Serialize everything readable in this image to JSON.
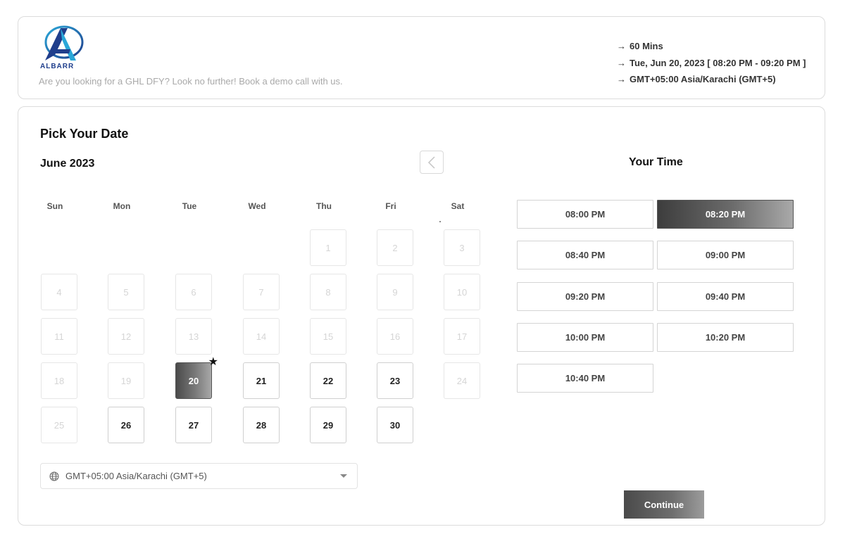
{
  "header": {
    "brand": "ALBARR",
    "tagline": "Are you looking for a GHL DFY? Look no further! Book a demo call with us.",
    "summary": {
      "duration": "60 Mins",
      "datetime": "Tue, Jun 20, 2023 [ 08:20 PM - 09:20 PM ]",
      "timezone": "GMT+05:00 Asia/Karachi (GMT+5)"
    }
  },
  "calendar": {
    "title": "Pick Your Date",
    "month": "June 2023",
    "weekdays": [
      "Sun",
      "Mon",
      "Tue",
      "Wed",
      "Thu",
      "Fri",
      "Sat"
    ],
    "selected_day": "20",
    "days": [
      {
        "label": "1",
        "state": "disabled"
      },
      {
        "label": "2",
        "state": "disabled"
      },
      {
        "label": "3",
        "state": "disabled"
      },
      {
        "label": "4",
        "state": "disabled"
      },
      {
        "label": "5",
        "state": "disabled"
      },
      {
        "label": "6",
        "state": "disabled"
      },
      {
        "label": "7",
        "state": "disabled"
      },
      {
        "label": "8",
        "state": "disabled"
      },
      {
        "label": "9",
        "state": "disabled"
      },
      {
        "label": "10",
        "state": "disabled"
      },
      {
        "label": "11",
        "state": "disabled"
      },
      {
        "label": "12",
        "state": "disabled"
      },
      {
        "label": "13",
        "state": "disabled"
      },
      {
        "label": "14",
        "state": "disabled"
      },
      {
        "label": "15",
        "state": "disabled"
      },
      {
        "label": "16",
        "state": "disabled"
      },
      {
        "label": "17",
        "state": "disabled"
      },
      {
        "label": "18",
        "state": "disabled"
      },
      {
        "label": "19",
        "state": "disabled"
      },
      {
        "label": "20",
        "state": "selected"
      },
      {
        "label": "21",
        "state": "enabled"
      },
      {
        "label": "22",
        "state": "enabled"
      },
      {
        "label": "23",
        "state": "enabled"
      },
      {
        "label": "24",
        "state": "disabled"
      },
      {
        "label": "25",
        "state": "disabled"
      },
      {
        "label": "26",
        "state": "enabled"
      },
      {
        "label": "27",
        "state": "enabled"
      },
      {
        "label": "28",
        "state": "enabled"
      },
      {
        "label": "29",
        "state": "enabled"
      },
      {
        "label": "30",
        "state": "enabled"
      }
    ],
    "timezone_select": "GMT+05:00 Asia/Karachi (GMT+5)"
  },
  "time": {
    "title": "Your Time",
    "selected": "08:20 PM",
    "slots": [
      "08:00 PM",
      "08:20 PM",
      "08:40 PM",
      "09:00 PM",
      "09:20 PM",
      "09:40 PM",
      "10:00 PM",
      "10:20 PM",
      "10:40 PM"
    ]
  },
  "actions": {
    "continue_label": "Continue"
  },
  "colors": {
    "brand_blue": "#1f3e8c",
    "brand_cyan": "#2aa7d8",
    "selected_dark": "#3d3d3d"
  }
}
